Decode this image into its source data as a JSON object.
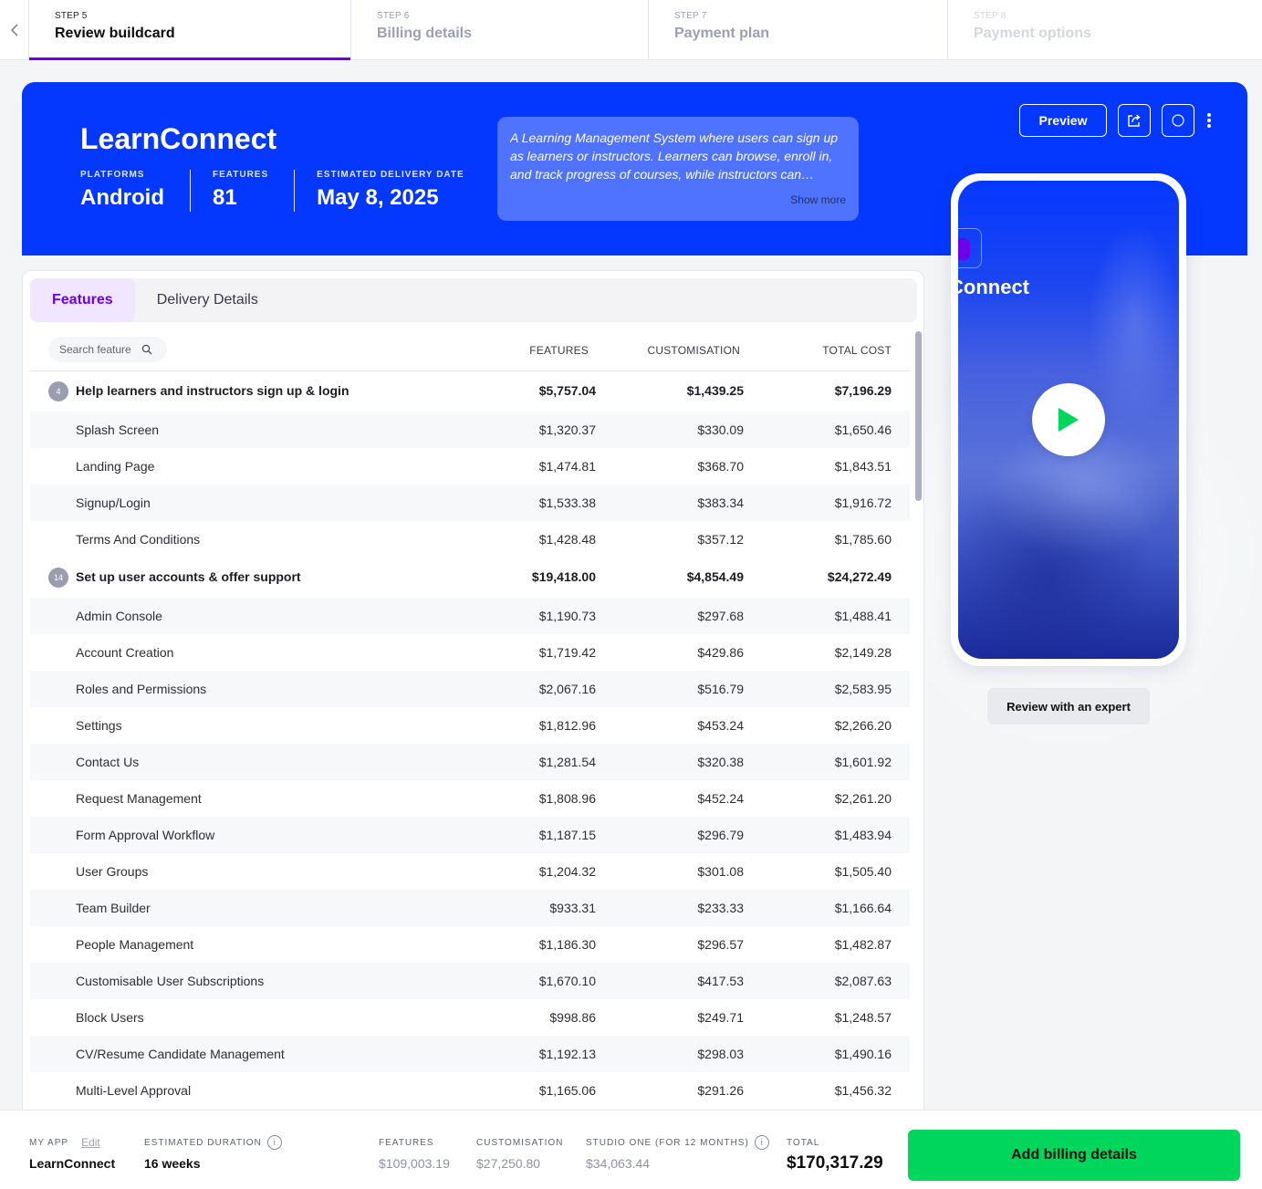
{
  "steps": [
    {
      "number": "STEP 5",
      "title": "Review buildcard",
      "state": "active"
    },
    {
      "number": "STEP 6",
      "title": "Billing details",
      "state": "upcoming"
    },
    {
      "number": "STEP 7",
      "title": "Payment plan",
      "state": "upcoming"
    },
    {
      "number": "STEP 8",
      "title": "Payment options",
      "state": "disabled"
    }
  ],
  "hero": {
    "app_name": "LearnConnect",
    "platforms_label": "PLATFORMS",
    "platforms_value": "Android",
    "features_label": "FEATURES",
    "features_value": "81",
    "delivery_label": "ESTIMATED DELIVERY DATE",
    "delivery_value": "May 8, 2025",
    "description": "A Learning Management System where users can sign up as learners or instructors. Learners can browse, enroll in, and track progress of courses, while instructors can…",
    "show_more": "Show more",
    "preview_label": "Preview",
    "brand_color": "#0538ff"
  },
  "phone": {
    "app_name_partial": "Connect",
    "expert_button": "Review with an expert"
  },
  "features": {
    "tabs": [
      {
        "label": "Features",
        "active": true
      },
      {
        "label": "Delivery Details",
        "active": false
      }
    ],
    "search_placeholder": "Search feature",
    "columns": [
      "FEATURES",
      "CUSTOMISATION",
      "TOTAL COST"
    ],
    "groups": [
      {
        "count": "4",
        "name": "Help learners and instructors sign up & login",
        "features": "$5,757.04",
        "customisation": "$1,439.25",
        "total": "$7,196.29",
        "items": [
          {
            "name": "Splash Screen",
            "features": "$1,320.37",
            "customisation": "$330.09",
            "total": "$1,650.46"
          },
          {
            "name": "Landing Page",
            "features": "$1,474.81",
            "customisation": "$368.70",
            "total": "$1,843.51"
          },
          {
            "name": "Signup/Login",
            "features": "$1,533.38",
            "customisation": "$383.34",
            "total": "$1,916.72"
          },
          {
            "name": "Terms And Conditions",
            "features": "$1,428.48",
            "customisation": "$357.12",
            "total": "$1,785.60"
          }
        ]
      },
      {
        "count": "14",
        "name": "Set up user accounts & offer support",
        "features": "$19,418.00",
        "customisation": "$4,854.49",
        "total": "$24,272.49",
        "items": [
          {
            "name": "Admin Console",
            "features": "$1,190.73",
            "customisation": "$297.68",
            "total": "$1,488.41"
          },
          {
            "name": "Account Creation",
            "features": "$1,719.42",
            "customisation": "$429.86",
            "total": "$2,149.28"
          },
          {
            "name": "Roles and Permissions",
            "features": "$2,067.16",
            "customisation": "$516.79",
            "total": "$2,583.95"
          },
          {
            "name": "Settings",
            "features": "$1,812.96",
            "customisation": "$453.24",
            "total": "$2,266.20"
          },
          {
            "name": "Contact Us",
            "features": "$1,281.54",
            "customisation": "$320.38",
            "total": "$1,601.92"
          },
          {
            "name": "Request Management",
            "features": "$1,808.96",
            "customisation": "$452.24",
            "total": "$2,261.20"
          },
          {
            "name": "Form Approval Workflow",
            "features": "$1,187.15",
            "customisation": "$296.79",
            "total": "$1,483.94"
          },
          {
            "name": "User Groups",
            "features": "$1,204.32",
            "customisation": "$301.08",
            "total": "$1,505.40"
          },
          {
            "name": "Team Builder",
            "features": "$933.31",
            "customisation": "$233.33",
            "total": "$1,166.64"
          },
          {
            "name": "People Management",
            "features": "$1,186.30",
            "customisation": "$296.57",
            "total": "$1,482.87"
          },
          {
            "name": "Customisable User Subscriptions",
            "features": "$1,670.10",
            "customisation": "$417.53",
            "total": "$2,087.63"
          },
          {
            "name": "Block Users",
            "features": "$998.86",
            "customisation": "$249.71",
            "total": "$1,248.57"
          },
          {
            "name": "CV/Resume Candidate Management",
            "features": "$1,192.13",
            "customisation": "$298.03",
            "total": "$1,490.16"
          },
          {
            "name": "Multi-Level Approval",
            "features": "$1,165.06",
            "customisation": "$291.26",
            "total": "$1,456.32"
          }
        ]
      }
    ]
  },
  "footer": {
    "my_app_label": "MY APP",
    "edit_label": "Edit",
    "my_app_value": "LearnConnect",
    "duration_label": "ESTIMATED DURATION",
    "duration_value": "16 weeks",
    "features_label": "FEATURES",
    "features_value": "$109,003.19",
    "customisation_label": "CUSTOMISATION",
    "customisation_value": "$27,250.80",
    "studio_label": "STUDIO ONE (FOR 12 MONTHS)",
    "studio_value": "$34,063.44",
    "total_label": "TOTAL",
    "total_value": "$170,317.29",
    "cta_label": "Add billing details",
    "cta_color": "#00d65b"
  }
}
